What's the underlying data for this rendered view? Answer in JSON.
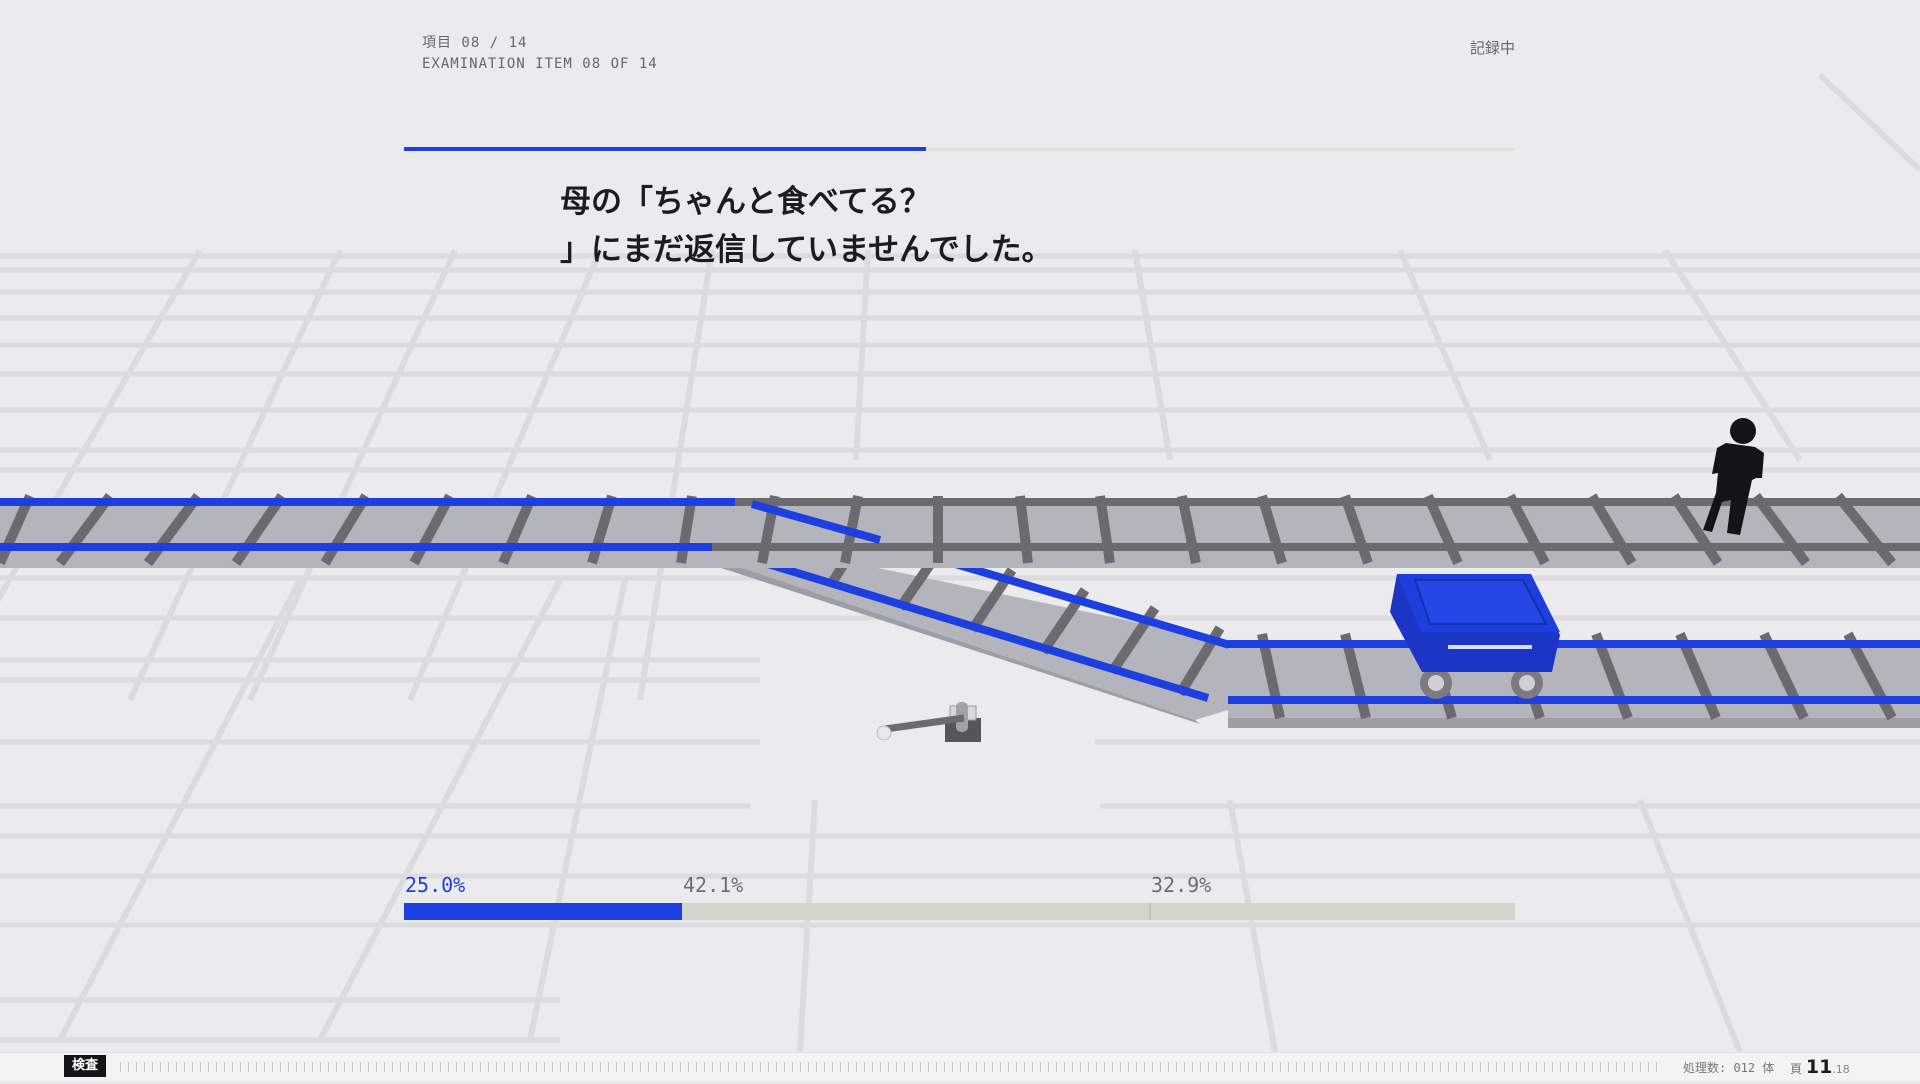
{
  "header": {
    "item_jp": "項目 08 / 14",
    "item_en": "EXAMINATION ITEM 08 OF 14",
    "status": "記録中",
    "progress": 0.47
  },
  "prompt": {
    "line1": "母の「ちゃんと食べてる？",
    "line2": "」にまだ返信していませんでした。"
  },
  "split": {
    "segments": [
      {
        "label": "25.0%",
        "value": 25.0,
        "color": "#1e3fe0"
      },
      {
        "label": "42.1%",
        "value": 42.1,
        "color": "#d4d4cc"
      },
      {
        "label": "32.9%",
        "value": 32.9,
        "color": "#d4d4cc"
      }
    ]
  },
  "footer": {
    "tag": "検査",
    "stats": "処理数: 012 体",
    "page_label": "頁",
    "page_main": "11",
    "page_sub": ".18"
  },
  "colors": {
    "accent": "#1e3fe0",
    "background": "#ebebed",
    "rail": "#6b6b6f",
    "trackbed": "#b3b4bc"
  }
}
